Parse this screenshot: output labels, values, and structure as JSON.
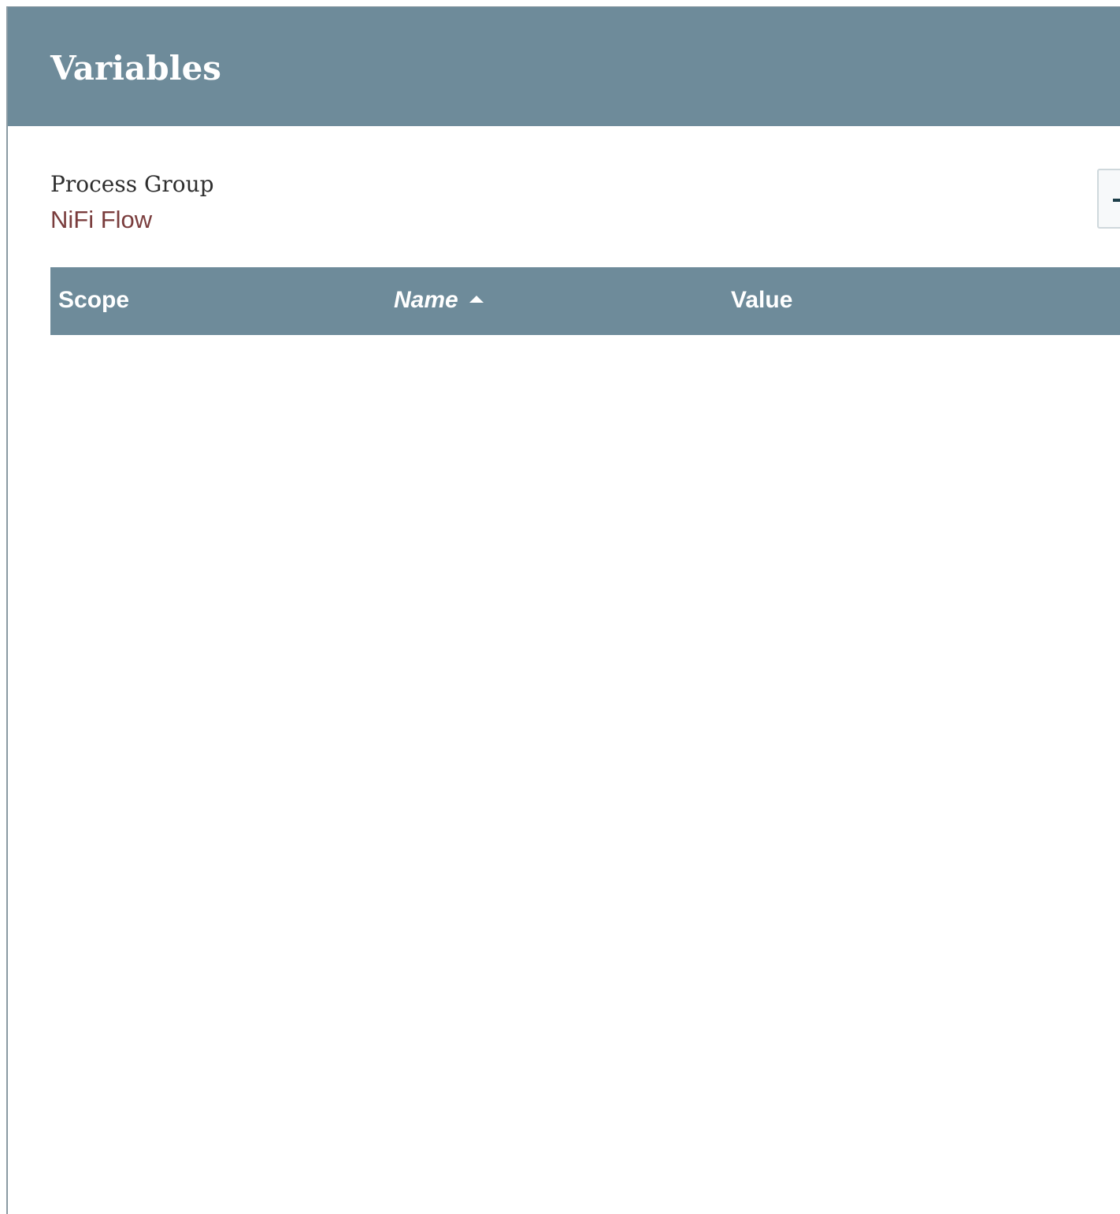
{
  "dialog": {
    "title": "Variables"
  },
  "process_group": {
    "label": "Process Group",
    "name": "NiFi Flow"
  },
  "toolbar": {
    "add_icon": "plus-icon"
  },
  "table": {
    "columns": [
      {
        "label": "Scope"
      },
      {
        "label": "Name",
        "sorted": "ascending"
      },
      {
        "label": "Value"
      }
    ],
    "rows": []
  },
  "colors": {
    "header_bg": "#6e8b9a",
    "link_text": "#7a3d3d"
  }
}
